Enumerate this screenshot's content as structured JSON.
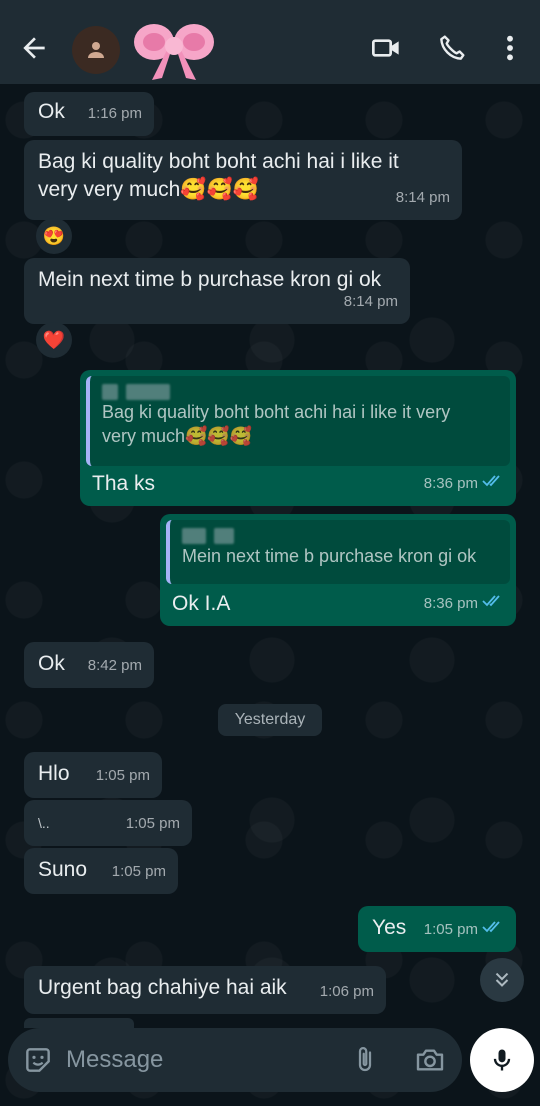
{
  "header": {
    "back_label": "back",
    "avatar_icon": "person-icon",
    "contact_sticker": "pink-bow"
  },
  "messages": [
    {
      "dir": "in",
      "text": "Ok",
      "time": "1:16 pm"
    },
    {
      "dir": "in",
      "text_line1": "Bag ki quality boht boht achi hai i like it",
      "text_line2": "very very much🥰🥰🥰",
      "time": "8:14 pm",
      "reaction": "😍"
    },
    {
      "dir": "in",
      "text": "Mein next time b purchase kron gi ok",
      "time": "8:14 pm",
      "reaction": "❤️"
    },
    {
      "dir": "out",
      "quote_line1": "Bag ki quality boht boht achi hai i like it very",
      "quote_line2": "very much🥰🥰🥰",
      "text": "Tha ks",
      "time": "8:36 pm"
    },
    {
      "dir": "out",
      "quote": "Mein next time b purchase kron gi ok",
      "text": "Ok I.A",
      "time": "8:36 pm"
    },
    {
      "dir": "in",
      "text": "Ok",
      "time": "8:42 pm"
    },
    {
      "dir": "in",
      "text": "Hlo",
      "time": "1:05 pm"
    },
    {
      "dir": "in",
      "text": "\\..",
      "time": "1:05 pm"
    },
    {
      "dir": "in",
      "text": "Suno",
      "time": "1:05 pm"
    },
    {
      "dir": "out",
      "text": "Yes",
      "time": "1:05 pm"
    },
    {
      "dir": "in",
      "text": "Urgent bag chahiye hai aik",
      "time": "1:06 pm"
    }
  ],
  "day_divider": "Yesterday",
  "composer": {
    "placeholder": "Message"
  },
  "colors": {
    "incoming_bubble": "#1f2c34",
    "outgoing_bubble": "#005c4b",
    "read_ticks": "#53bdeb",
    "quote_bar": "#a5b3f7"
  }
}
